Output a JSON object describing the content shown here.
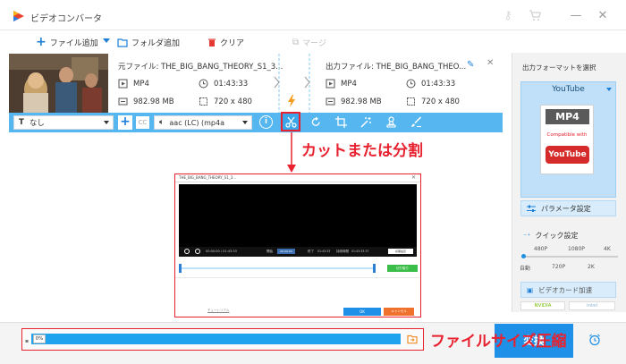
{
  "app": {
    "title": "ビデオコンバータ"
  },
  "toolbar": {
    "add_file": "ファイル追加",
    "add_folder": "フォルダ追加",
    "clear": "クリア",
    "merge": "マージ"
  },
  "file": {
    "source_label": "元ファイル: THE_BIG_BANG_THEORY_S1_3...",
    "source_format": "MP4",
    "source_duration": "01:43:33",
    "source_size": "982.98 MB",
    "source_resolution": "720 x 480",
    "output_label": "出力ファイル: THE_BIG_BANG_THEO...",
    "output_format": "MP4",
    "output_duration": "01:43:33",
    "output_size": "982.98 MB",
    "output_resolution": "720 x 480"
  },
  "editbar": {
    "subtitle": "なし",
    "audio": "aac (LC) (mp4a"
  },
  "annotation": {
    "cut_label": "カットまたは分割",
    "compress_label": "ファイルサイズ圧縮"
  },
  "preview": {
    "title": "THE_BIG_BANG_THEORY_S1_3...",
    "time_current": "00:00:00",
    "time_total": "01:43:33",
    "start_label": "開始",
    "start_value": "00:00:00",
    "end_label": "終了",
    "end_value": "01:43:33",
    "duration_label": "持続時間",
    "duration_value": "01:43:33.37",
    "reset": "初期設定",
    "cut_btn": "切り取り",
    "tutorial": "チュートリアル",
    "ok": "OK",
    "cancel": "キャンセル"
  },
  "right_panel": {
    "select_format": "出力フォーマットを選択",
    "format_name": "YouTube",
    "mp4_badge": "MP4",
    "compatible": "Compatible with",
    "youtube_logo": "YouTube",
    "param_settings": "パラメータ設定",
    "quick_settings": "クイック設定",
    "q_480": "480P",
    "q_1080": "1080P",
    "q_4k": "4K",
    "q_auto": "自動",
    "q_720": "720P",
    "q_2k": "2K",
    "hw_accel": "ビデオカード加速",
    "nvidia": "NVIDIA",
    "intel": "intel"
  },
  "bottom": {
    "progress": "0%",
    "progress_value": 0,
    "run": "変換"
  },
  "colors": {
    "accent": "#1e90e8",
    "bar": "#55b6f0",
    "annotation_red": "#e8212f",
    "progress_blue": "#1fa3ef"
  }
}
